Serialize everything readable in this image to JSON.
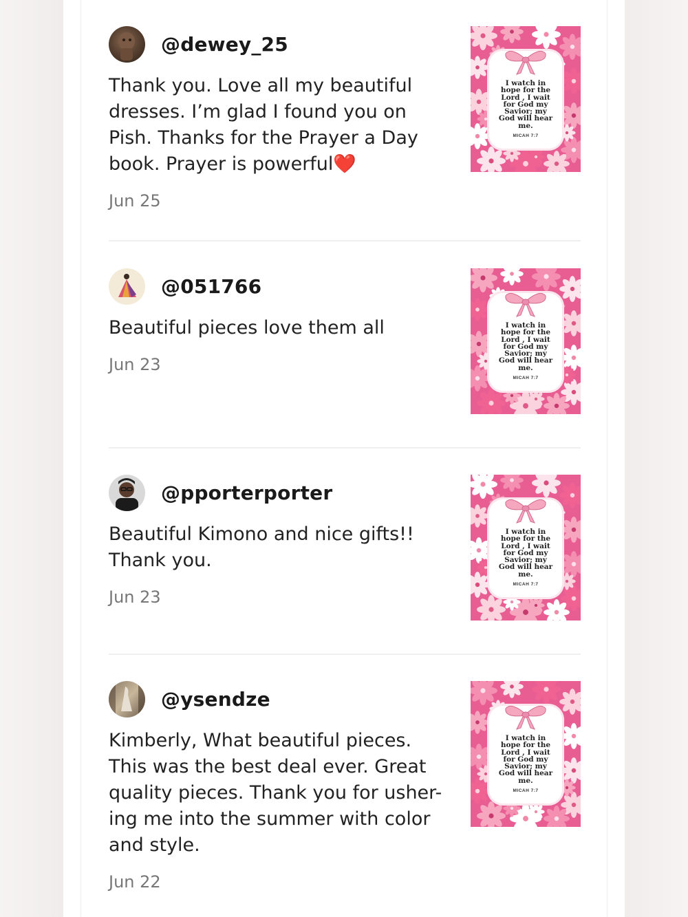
{
  "reviews": [
    {
      "username": "@dewey_25",
      "text": "Thank you. Love all my beautiful dresses. I’m glad I found you on Pish. Thanks for the Prayer a Day book. Prayer is powerful❤️",
      "date": "Jun 25",
      "avatar": "carved-figure-avatar"
    },
    {
      "username": "@051766",
      "text": "Beautiful pieces love them all",
      "date": "Jun 23",
      "avatar": "dancer-illustration-avatar"
    },
    {
      "username": "@pporterporter",
      "text": "Beautiful Kimono and nice gifts!! Thank you.",
      "date": "Jun 23",
      "avatar": "woman-glasses-avatar"
    },
    {
      "username": "@ysendze",
      "text": "Kimberly, What beautiful pieces. This was the best deal ever. Great quality pieces. Thank you for usher-ing me into the summer with color and style.",
      "date": "Jun 22",
      "avatar": "statue-photo-avatar"
    }
  ],
  "thumbnail": {
    "verse_lines": [
      "I watch in",
      "hope for the",
      "Lord , I wait",
      "for God my",
      "Savior; my",
      "God will hear",
      "me."
    ],
    "reference": "MICAH 7:7"
  },
  "colors": {
    "accent_pink": "#e85d92",
    "bow_pink": "#f5a7c0",
    "text": "#222222",
    "muted": "#777777"
  }
}
